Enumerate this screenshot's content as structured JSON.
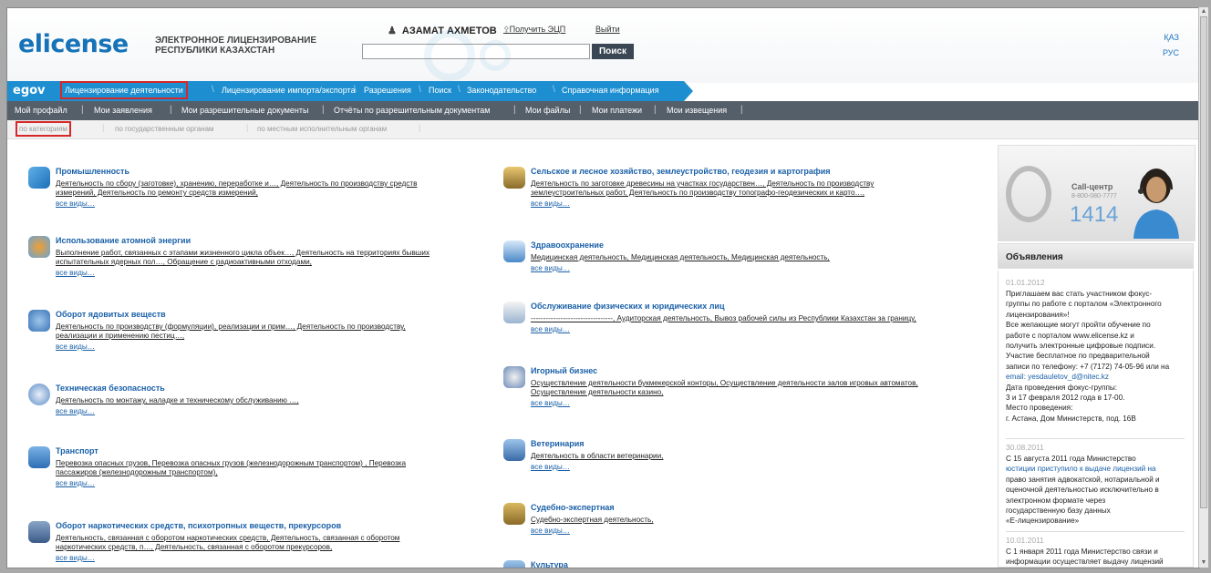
{
  "header": {
    "logo": "elicense",
    "logo_sub_1": "ЭЛЕКТРОННОЕ ЛИЦЕНЗИРОВАНИЕ",
    "logo_sub_2": "РЕСПУБЛИКИ КАЗАХСТАН",
    "user_name": "АЗАМАТ АХМЕТОВ",
    "get_ecp": "Получить ЭЦП",
    "logout": "Выйти",
    "search_button": "Поиск",
    "lang_kaz": "ҚАЗ",
    "lang_rus": "РУС"
  },
  "main_nav": {
    "egov": "egov",
    "items": [
      "Лицензирование деятельности",
      "Лицензирование импорта/экспорта",
      "Разрешения",
      "Поиск",
      "Законодательство",
      "Справочная информация"
    ]
  },
  "sub_nav": {
    "items": [
      "Мой профайл",
      "Мои заявления",
      "Мои разрешительные документы",
      "Отчёты по разрешительным документам",
      "Мои файлы",
      "Мои платежи",
      "Мои извещения"
    ]
  },
  "tertiary_nav": {
    "items": [
      "по категориям",
      "по государственным органам",
      "по местным исполнительным органам"
    ]
  },
  "categories_left": [
    {
      "title": "Промышленность",
      "desc_1": "Деятельность по сбору (заготовке), хранению, переработке и…, Деятельность по производству средств",
      "desc_2": "измерений, Деятельность по ремонту средств измерений,",
      "all": "все виды…"
    },
    {
      "title": "Использование атомной энергии",
      "desc_1": "Выполнение работ, связанных с этапами жизненного цикла объек…, Деятельность на территориях бывших",
      "desc_2": "испытательных ядерных пол…, Обращение с радиоактивными отходами,",
      "all": "все виды…"
    },
    {
      "title": "Оборот ядовитых веществ",
      "desc_1": "Деятельность по производству (формуляции), реализации и прим…, Деятельность по производству,",
      "desc_2": "реализации и применению пестиц…,",
      "all": "все виды…"
    },
    {
      "title": "Техническая безопасность",
      "desc_1": "Деятельность по монтажу, наладке и техническому обслуживанию …,",
      "desc_2": "",
      "all": "все виды…"
    },
    {
      "title": "Транспорт",
      "desc_1": "Перевозка опасных грузов, Перевозка опасных грузов (железнодорожным транспортом) , Перевозка",
      "desc_2": "пассажиров (железнодорожным транспортом),",
      "all": "все виды…"
    },
    {
      "title": "Оборот наркотических средств, психотропных веществ, прекурсоров",
      "desc_1": "Деятельность, связанная с оборотом наркотических средств, Деятельность, связанная с оборотом",
      "desc_2": "наркотических средств, п…, Деятельность, связанная с оборотом прекурсоров,",
      "all": "все виды…"
    }
  ],
  "categories_right": [
    {
      "title": "Сельское и лесное хозяйство, землеустройство, геодезия и картография",
      "desc_1": "Деятельность по заготовке древесины на участках государствен…, Деятельность по производству",
      "desc_2": "землеустроительных работ, Деятельность по производству топографо-геодезических и карто…,",
      "all": "все виды…"
    },
    {
      "title": "Здравоохранение",
      "desc_1": "Медицинская деятельность, Медицинская деятельность, Медицинская деятельность,",
      "desc_2": "",
      "all": "все виды…"
    },
    {
      "title": "Обслуживание физических и юридических лиц",
      "desc_1": "---------------------------------, Аудиторская деятельность, Вывоз рабочей силы из Республики Казахстан за границу,",
      "desc_2": "",
      "all": "все виды…"
    },
    {
      "title": "Игорный бизнес",
      "desc_1": "Осуществление деятельности букмекерской конторы, Осуществление деятельности залов игровых автоматов,",
      "desc_2": "Осуществление деятельности казино,",
      "all": "все виды…"
    },
    {
      "title": "Ветеринария",
      "desc_1": "Деятельность в области ветеринарии,",
      "desc_2": "",
      "all": "все виды…"
    },
    {
      "title": "Судебно-экспертная",
      "desc_1": "Судебно-экспертная деятельность,",
      "desc_2": "",
      "all": "все виды…"
    },
    {
      "title": "Культура",
      "desc_1": "",
      "desc_2": "",
      "all": ""
    }
  ],
  "call_center": {
    "title": "Call-центр",
    "phone": "8-800-080-7777",
    "short": "1414"
  },
  "announcements": {
    "heading": "Объявления",
    "items": [
      {
        "date": "01.01.2012",
        "lines": [
          "Приглашаем вас стать участником фокус-",
          "группы по работе с порталом «Электронного",
          "лицензирования»!",
          "Все желающие могут пройти обучение по",
          "работе с порталом www.elicense.kz и",
          "получить электронные цифровые подписи.",
          "Участие бесплатное по предварительной",
          "записи по телефону: +7 (7172) 74-05-96 или на",
          "email: yesdauletov_d@nitec.kz",
          "Дата проведения фокус-группы:",
          "3 и 17 февраля 2012 года в 17-00.",
          "Место проведения:",
          "г. Астана, Дом Министерств, под. 16В"
        ]
      },
      {
        "date": "30.08.2011",
        "lines": [
          "С 15 августа 2011 года Министерство",
          "юстиции приступило к выдаче лицензий на",
          "право занятия адвокатской, нотариальной и",
          "оценочной деятельностью исключительно в",
          "электронном формате через",
          "государственную базу данных",
          "«Е-лицензирование»"
        ]
      },
      {
        "date": "10.01.2011",
        "lines": [
          "С 1 января 2011 года Министерство связи и",
          "информации осуществляет выдачу лицензий"
        ]
      }
    ]
  },
  "colors": {
    "brand_blue": "#1d8fd0",
    "dark_nav": "#555f6a",
    "highlight_red": "#d62828",
    "link_blue": "#1a60a8"
  }
}
